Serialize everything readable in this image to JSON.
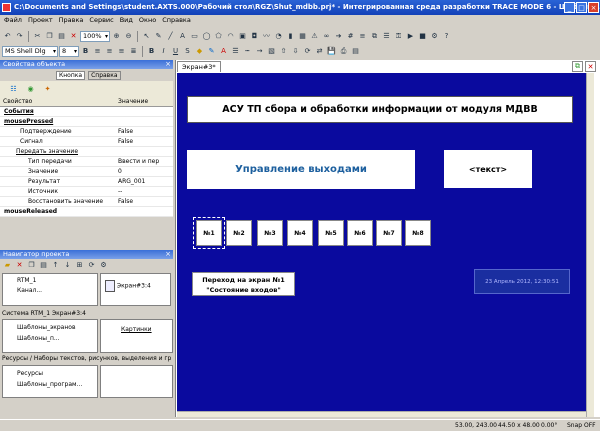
{
  "window": {
    "title": "C:\\Documents and Settings\\student.AXTS.000\\Рабочий стол\\RGZ\\Shut_mdbb.prj* - Интегрированная среда разработки TRACE MODE 6 - Шаблон..."
  },
  "menu": [
    "Файл",
    "Проект",
    "Правка",
    "Сервис",
    "Вид",
    "Окно",
    "Справка"
  ],
  "toolbar": {
    "zoom": "100%",
    "font": "MS Shell Dlg",
    "size": "8"
  },
  "props_panel": {
    "title": "Свойства объекта",
    "tabs": [
      "Кнопка",
      "Справка"
    ],
    "col_prop": "Свойство",
    "col_value": "Значение",
    "rows": [
      {
        "k": "События",
        "v": ""
      },
      {
        "k": "mousePressed",
        "v": ""
      },
      {
        "k": "Подтверждение",
        "v": "False"
      },
      {
        "k": "Сигнал",
        "v": "False"
      },
      {
        "k": "Передать значение",
        "v": ""
      },
      {
        "k": "Тип передачи",
        "v": "Ввести и пер"
      },
      {
        "k": "Значение",
        "v": "0"
      },
      {
        "k": "Результат",
        "v": "ARG_001"
      },
      {
        "k": "Источник",
        "v": "--"
      },
      {
        "k": "Восстановить значение",
        "v": "False"
      },
      {
        "k": "mouseReleased",
        "v": ""
      }
    ]
  },
  "nav_panel": {
    "title": "Навигатор проекта",
    "tree": [
      "RTM_1",
      "Канал..."
    ],
    "tile": "Экран#3:4",
    "path": "Система RTM_1 Экран#3:4",
    "templates": [
      "Шаблоны_экранов",
      "Шаблоны_п..."
    ],
    "pictures": "Картинки",
    "res_path": "Ресурсы / Наборы текстов, рисунков, выделения и гр",
    "resources": [
      "Ресурсы",
      "Шаблоны_програм..."
    ]
  },
  "tab": {
    "label": "Экран#3*"
  },
  "screen": {
    "header": "АСУ ТП сбора и обработки информации от модуля МДВВ",
    "control_title": "Управление выходами",
    "text_placeholder": "<текст>",
    "buttons": [
      "№1",
      "№2",
      "№3",
      "№4",
      "№5",
      "№6",
      "№7",
      "№8"
    ],
    "nav_button_line1": "Переход на экран №1",
    "nav_button_line2": "\"Состояние входов\"",
    "datetime": "23 Апрель 2012, 12:30:51"
  },
  "status": {
    "coords": "53.00, 243.00",
    "size": "44.50 x 48.00",
    "angle": "0.00°",
    "snap": "Snap OFF"
  },
  "colors": {
    "canvas": "#0a0a9e",
    "title": "#1e52c4"
  }
}
